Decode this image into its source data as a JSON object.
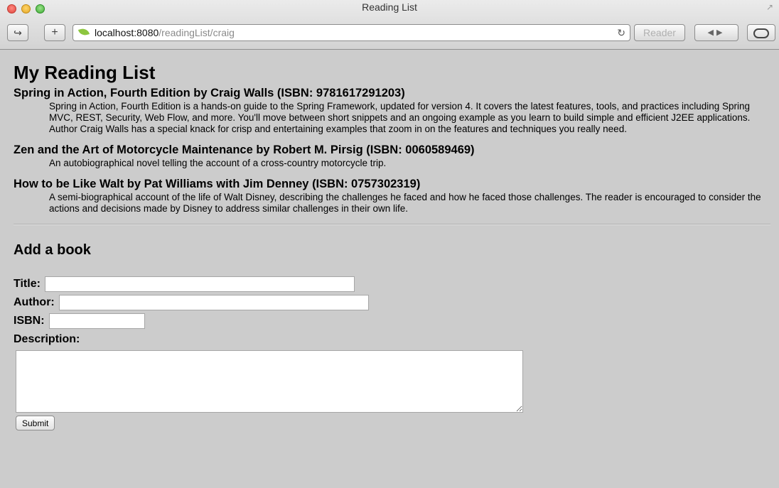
{
  "window": {
    "title": "Reading List",
    "url_host": "localhost:8080",
    "url_path": "/readingList/craig",
    "reader_label": "Reader"
  },
  "page": {
    "title": "My Reading List",
    "books": [
      {
        "heading": "Spring in Action, Fourth Edition by Craig Walls (ISBN: 9781617291203)",
        "description": "Spring in Action, Fourth Edition is a hands-on guide to the Spring Framework, updated for version 4. It covers the latest features, tools, and practices including Spring MVC, REST, Security, Web Flow, and more. You'll move between short snippets and an ongoing example as you learn to build simple and efficient J2EE applications. Author Craig Walls has a special knack for crisp and entertaining examples that zoom in on the features and techniques you really need."
      },
      {
        "heading": "Zen and the Art of Motorcycle Maintenance by Robert M. Pirsig (ISBN: 0060589469)",
        "description": "An autobiographical novel telling the account of a cross-country motorcycle trip."
      },
      {
        "heading": "How to be Like Walt by Pat Williams with Jim Denney (ISBN: 0757302319)",
        "description": "A semi-biographical account of the life of Walt Disney, describing the challenges he faced and how he faced those challenges. The reader is encouraged to consider the actions and decisions made by Disney to address similar challenges in their own life."
      }
    ]
  },
  "form": {
    "heading": "Add a book",
    "title_label": "Title:",
    "title_value": "",
    "author_label": "Author:",
    "author_value": "",
    "isbn_label": "ISBN:",
    "isbn_value": "",
    "description_label": "Description:",
    "description_value": "",
    "submit_label": "Submit"
  }
}
